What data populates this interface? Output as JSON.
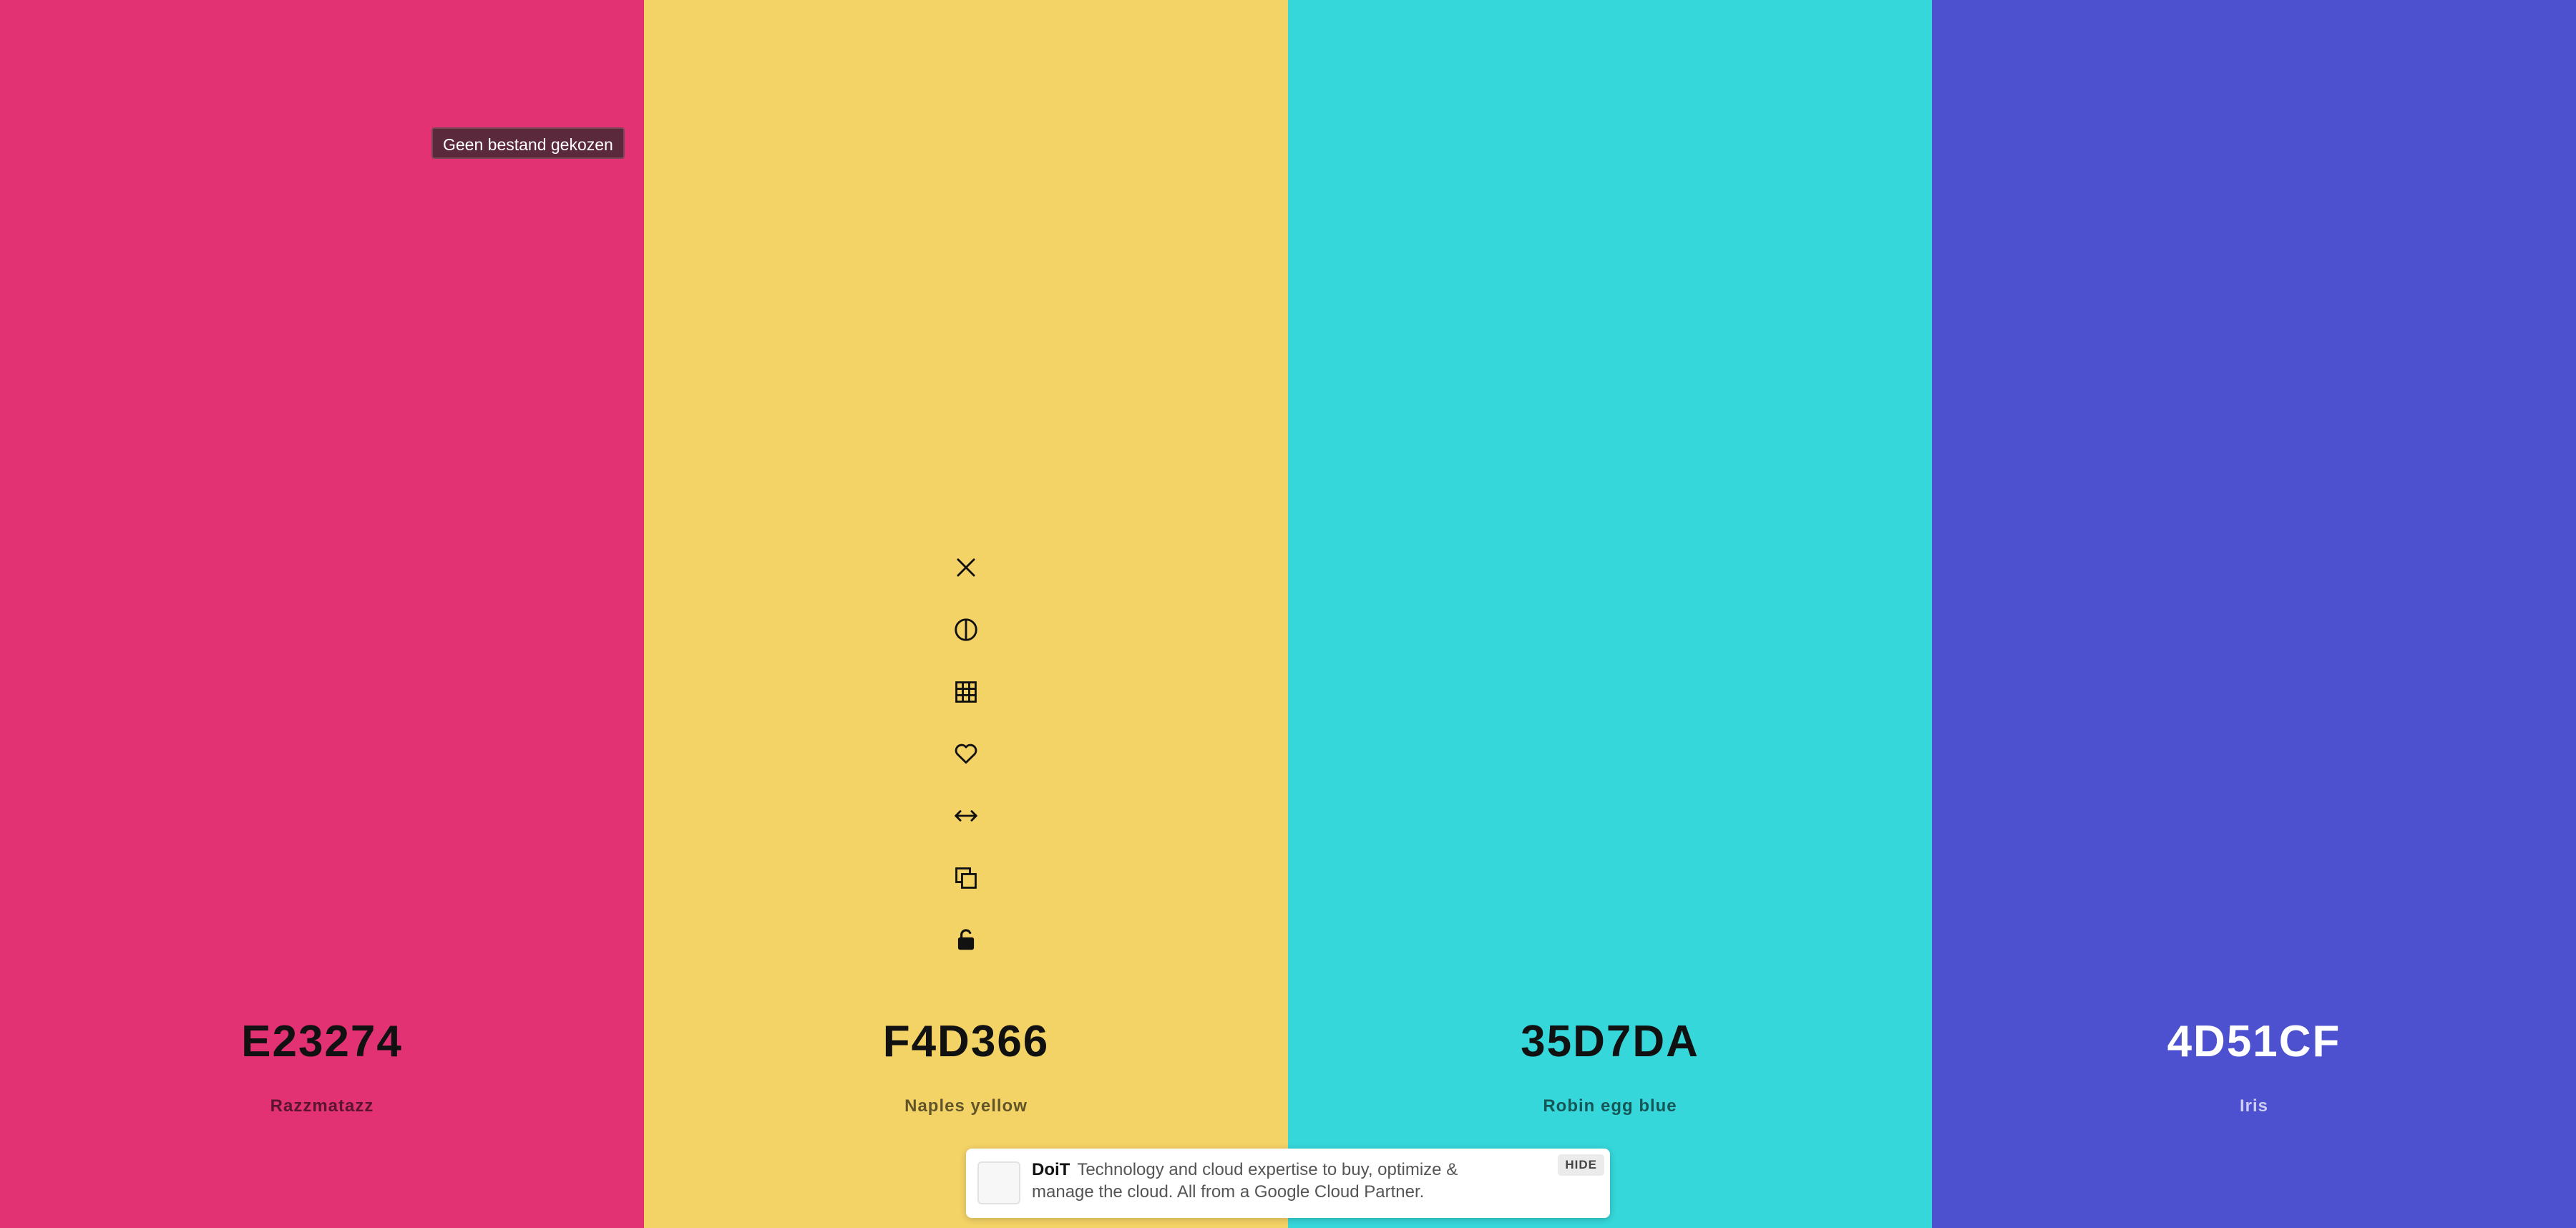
{
  "palette": {
    "colors": [
      {
        "hex": "E23274",
        "name": "Razzmatazz",
        "color": "#E23274",
        "text_tone": "dark"
      },
      {
        "hex": "F4D366",
        "name": "Naples yellow",
        "color": "#F4D366",
        "text_tone": "dark"
      },
      {
        "hex": "35D7DA",
        "name": "Robin egg blue",
        "color": "#35D7DA",
        "text_tone": "dark"
      },
      {
        "hex": "4D51CF",
        "name": "Iris",
        "color": "#4D51CF",
        "text_tone": "light"
      }
    ]
  },
  "tooltip": {
    "text": "Geen bestand gekozen"
  },
  "toolbar": {
    "icons": [
      "close-icon",
      "contrast-icon",
      "shades-grid-icon",
      "heart-icon",
      "drag-horizontal-icon",
      "copy-icon",
      "unlock-icon"
    ]
  },
  "ad": {
    "brand": "DoiT",
    "text": "Technology and cloud expertise to buy, optimize & manage the cloud. All from a Google Cloud Partner.",
    "hide_label": "HIDE"
  }
}
